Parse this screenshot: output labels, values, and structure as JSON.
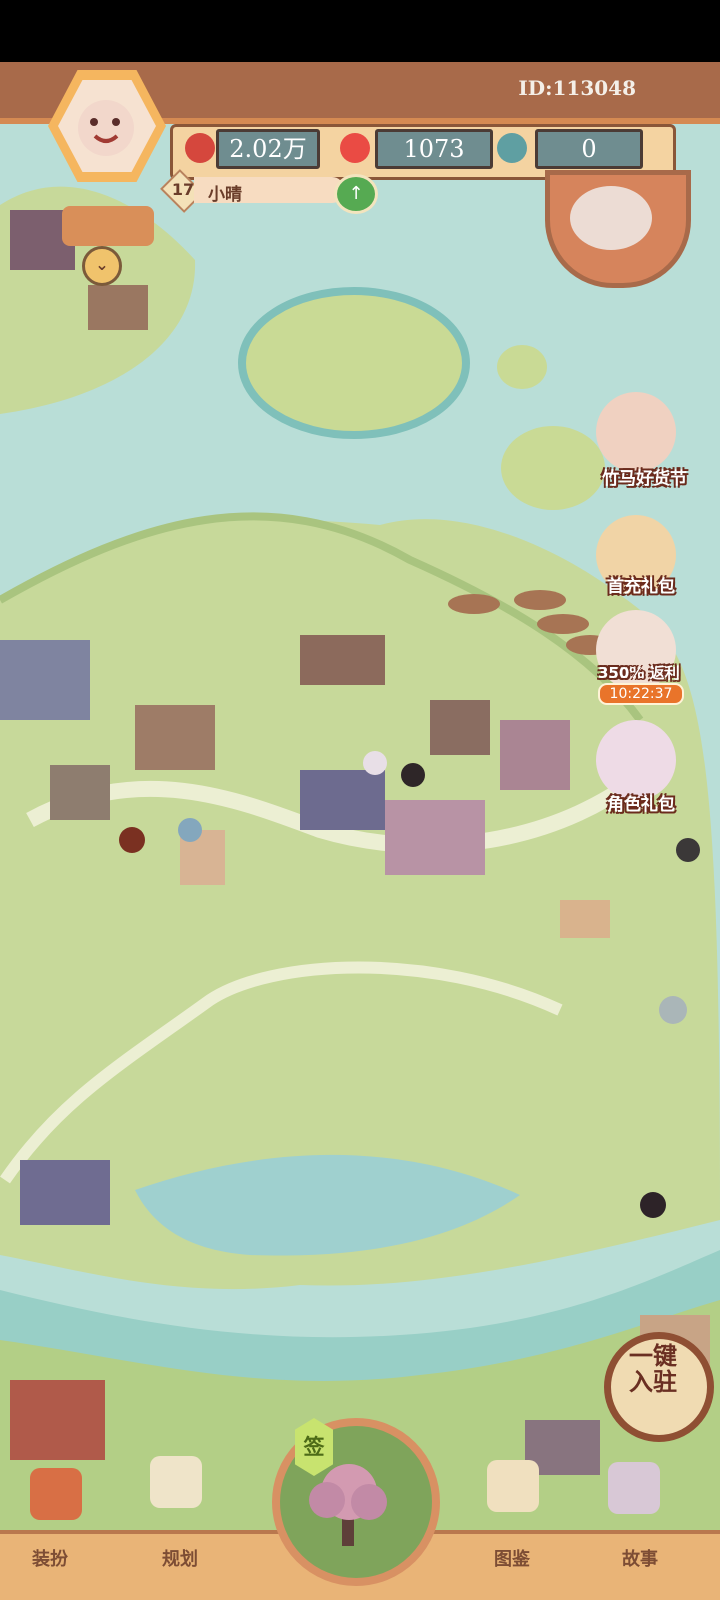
{
  "header": {
    "id_text": "ID:113048",
    "resources": {
      "coins": "2.02万",
      "peaches": "1073",
      "crystals": "0"
    },
    "player": {
      "level": "17",
      "name": "小晴"
    }
  },
  "events": [
    {
      "label": "竹马好货节"
    },
    {
      "label": "首充礼包"
    },
    {
      "label": "350% 返利",
      "timer": "10:22:37"
    },
    {
      "label": "角色礼包"
    }
  ],
  "floating": {
    "quick_settle": "一键入驻"
  },
  "bottom_nav": {
    "dress_up": "装扮",
    "plan": "规划",
    "sign": "签",
    "collection": "图鉴",
    "story": "故事"
  },
  "colors": {
    "water": "#b9ded7",
    "grass": "#c7d99a",
    "ui_brown": "#a86a4a",
    "ui_gold": "#f5b65f",
    "accent_red": "#d5473d"
  }
}
